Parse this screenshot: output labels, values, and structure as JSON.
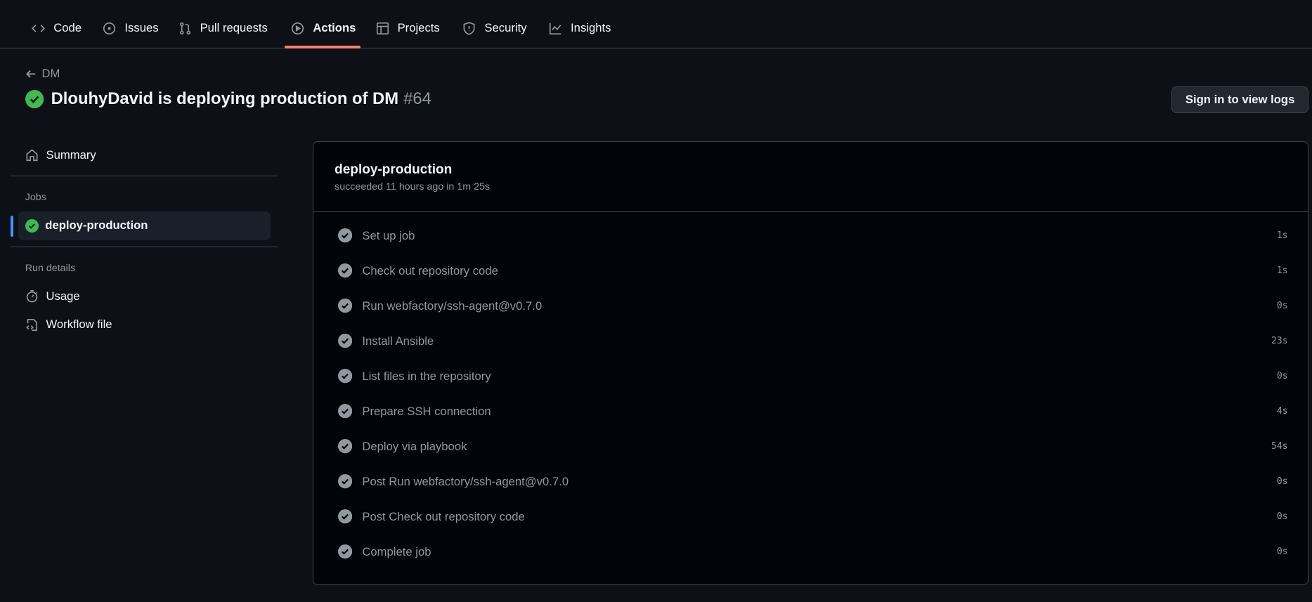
{
  "nav": {
    "items": [
      {
        "label": "Code",
        "icon": "code-icon"
      },
      {
        "label": "Issues",
        "icon": "issue-icon"
      },
      {
        "label": "Pull requests",
        "icon": "pull-request-icon"
      },
      {
        "label": "Actions",
        "icon": "play-icon",
        "active": true
      },
      {
        "label": "Projects",
        "icon": "table-icon"
      },
      {
        "label": "Security",
        "icon": "shield-icon"
      },
      {
        "label": "Insights",
        "icon": "graph-icon"
      }
    ],
    "active_color": "#f78166"
  },
  "header": {
    "back_label": "DM",
    "title": "DlouhyDavid is deploying production of DM",
    "run_number": "#64",
    "status": "success",
    "sign_in_button": "Sign in to view logs"
  },
  "sidebar": {
    "summary": "Summary",
    "jobs_heading": "Jobs",
    "job": "deploy-production",
    "run_details_heading": "Run details",
    "usage": "Usage",
    "workflow_file": "Workflow file"
  },
  "job": {
    "title": "deploy-production",
    "subtitle": "succeeded 11 hours ago in 1m 25s",
    "steps": [
      {
        "name": "Set up job",
        "duration": "1s"
      },
      {
        "name": "Check out repository code",
        "duration": "1s"
      },
      {
        "name": "Run webfactory/ssh-agent@v0.7.0",
        "duration": "0s"
      },
      {
        "name": "Install Ansible",
        "duration": "23s"
      },
      {
        "name": "List files in the repository",
        "duration": "0s"
      },
      {
        "name": "Prepare SSH connection",
        "duration": "4s"
      },
      {
        "name": "Deploy via playbook",
        "duration": "54s"
      },
      {
        "name": "Post Run webfactory/ssh-agent@v0.7.0",
        "duration": "0s"
      },
      {
        "name": "Post Check out repository code",
        "duration": "0s"
      },
      {
        "name": "Complete job",
        "duration": "0s"
      }
    ]
  },
  "colors": {
    "success": "#3fb950",
    "accent": "#4493f8",
    "background": "#0d1117"
  }
}
